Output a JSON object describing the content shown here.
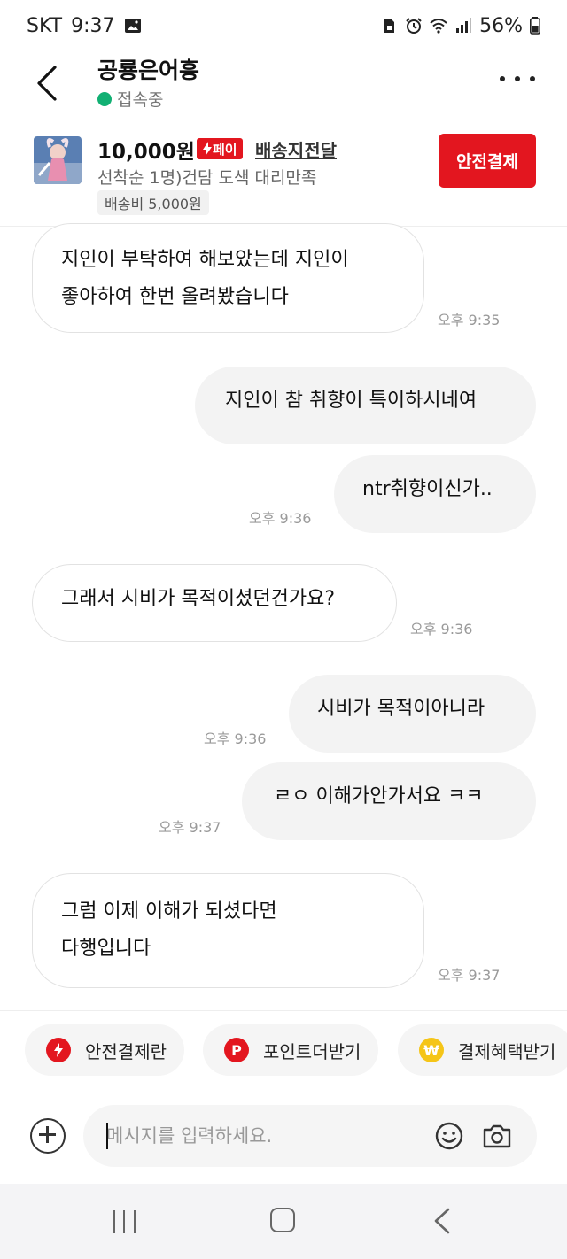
{
  "status_bar": {
    "carrier": "SKT",
    "time": "9:37",
    "battery": "56%"
  },
  "header": {
    "title": "공룡은어흥",
    "status": "접속중"
  },
  "product": {
    "price": "10,000원",
    "pay_badge": "페이",
    "delivery": "배송지전달",
    "name": "선착순 1명)건담 도색 대리만족",
    "shipping_fee": "배송비 5,000원",
    "safe_pay_button": "안전결제"
  },
  "messages": [
    {
      "from": "them",
      "lines": [
        "지인이 부탁하여 해보았는데 지인이",
        "좋아하여 한번 올려봤습니다"
      ],
      "time": "오후 9:35"
    },
    {
      "from": "me",
      "text": "지인이 참 취향이 특이하시네여"
    },
    {
      "from": "me",
      "text": "ntr취향이신가..",
      "time": "오후 9:36"
    },
    {
      "from": "them",
      "text": "그래서 시비가 목적이셨던건가요?",
      "time": "오후 9:36"
    },
    {
      "from": "me",
      "text": "시비가 목적이아니라",
      "time": "오후 9:36"
    },
    {
      "from": "me",
      "text": "ㄹㅇ 이해가안가서요 ㅋㅋ",
      "time": "오후 9:37"
    },
    {
      "from": "them",
      "lines": [
        "그럼 이제 이해가 되셨다면",
        "다행입니다"
      ],
      "time": "오후 9:37"
    }
  ],
  "quick_actions": [
    {
      "label": "안전결제란",
      "icon": "lightning-icon",
      "color": "#e3161f"
    },
    {
      "label": "포인트더받기",
      "icon": "point-p-icon",
      "color": "#e3161f"
    },
    {
      "label": "결제혜택받기",
      "icon": "won-coin-icon",
      "color": "#f5c518"
    }
  ],
  "composer": {
    "placeholder": "메시지를 입력하세요."
  },
  "colors": {
    "accent": "#e3161f",
    "online": "#11b073"
  }
}
